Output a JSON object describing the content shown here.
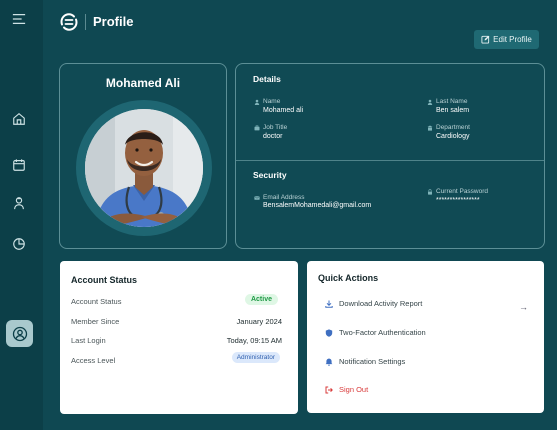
{
  "header": {
    "title": "Profile",
    "edit_button": "Edit Profile"
  },
  "profile": {
    "name": "Mohamed Ali"
  },
  "details": {
    "title": "Details",
    "fields": [
      {
        "label": "Name",
        "value": "Mohamed ali"
      },
      {
        "label": "Last Name",
        "value": "Ben salem"
      },
      {
        "label": "Job Title",
        "value": "doctor"
      },
      {
        "label": "Department",
        "value": "Cardiology"
      }
    ]
  },
  "security": {
    "title": "Security",
    "email_label": "Email Address",
    "email_value": "BensalemMohamedali@gmail.com",
    "password_label": "Current Password",
    "password_value": "****************"
  },
  "account_status": {
    "title": "Account Status",
    "rows": [
      {
        "label": "Account Status",
        "value": "Active"
      },
      {
        "label": "Member Since",
        "value": "January 2024"
      },
      {
        "label": "Last Login",
        "value": "Today, 09:15 AM"
      },
      {
        "label": "Access Level",
        "value": "Administrator"
      }
    ]
  },
  "quick_actions": {
    "title": "Quick Actions",
    "items": [
      {
        "label": "Download Activity Report",
        "icon": "download-icon"
      },
      {
        "label": "Two-Factor Authentication",
        "icon": "shield-icon"
      },
      {
        "label": "Notification Settings",
        "icon": "bell-icon"
      },
      {
        "label": "Sign Out",
        "icon": "sign-out-icon"
      }
    ],
    "arrow": "→"
  },
  "sidebar": {
    "items": [
      "menu-icon",
      "home-icon",
      "calendar-icon",
      "doctor-icon",
      "chart-icon",
      "user-icon"
    ]
  },
  "colors": {
    "background": "#0f4852",
    "sidebar": "#0c3f48",
    "active_green": "#1f9a45",
    "admin_blue": "#2f5fae",
    "danger": "#d93b3b"
  }
}
